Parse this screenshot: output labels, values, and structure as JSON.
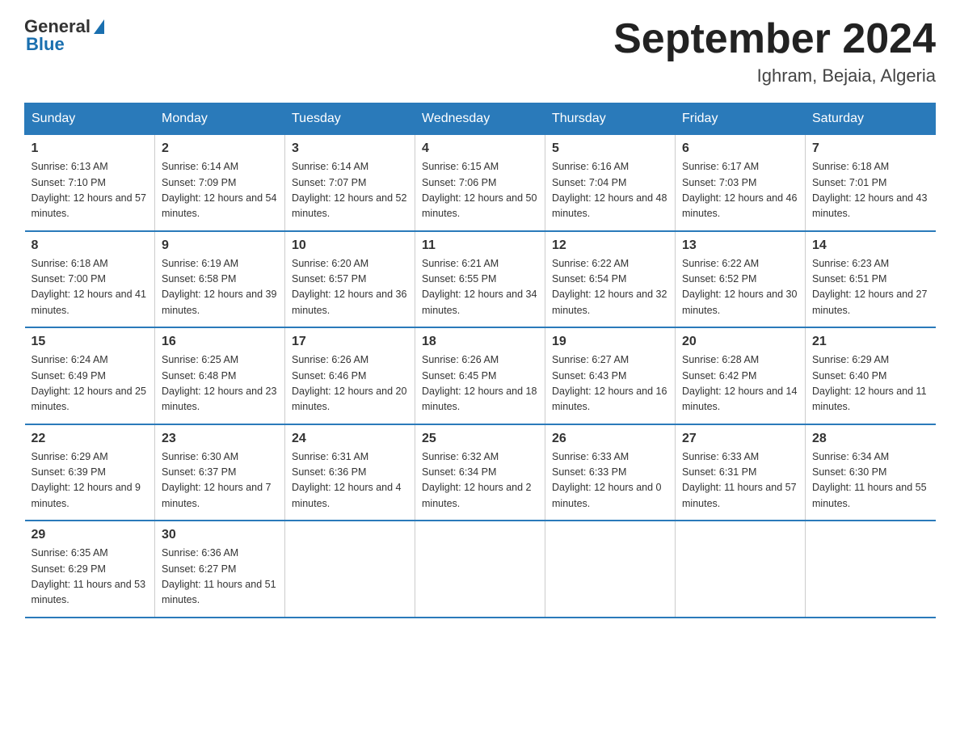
{
  "header": {
    "logo_general": "General",
    "logo_blue": "Blue",
    "title": "September 2024",
    "location": "Ighram, Bejaia, Algeria"
  },
  "columns": [
    "Sunday",
    "Monday",
    "Tuesday",
    "Wednesday",
    "Thursday",
    "Friday",
    "Saturday"
  ],
  "weeks": [
    [
      {
        "day": "1",
        "sunrise": "Sunrise: 6:13 AM",
        "sunset": "Sunset: 7:10 PM",
        "daylight": "Daylight: 12 hours and 57 minutes."
      },
      {
        "day": "2",
        "sunrise": "Sunrise: 6:14 AM",
        "sunset": "Sunset: 7:09 PM",
        "daylight": "Daylight: 12 hours and 54 minutes."
      },
      {
        "day": "3",
        "sunrise": "Sunrise: 6:14 AM",
        "sunset": "Sunset: 7:07 PM",
        "daylight": "Daylight: 12 hours and 52 minutes."
      },
      {
        "day": "4",
        "sunrise": "Sunrise: 6:15 AM",
        "sunset": "Sunset: 7:06 PM",
        "daylight": "Daylight: 12 hours and 50 minutes."
      },
      {
        "day": "5",
        "sunrise": "Sunrise: 6:16 AM",
        "sunset": "Sunset: 7:04 PM",
        "daylight": "Daylight: 12 hours and 48 minutes."
      },
      {
        "day": "6",
        "sunrise": "Sunrise: 6:17 AM",
        "sunset": "Sunset: 7:03 PM",
        "daylight": "Daylight: 12 hours and 46 minutes."
      },
      {
        "day": "7",
        "sunrise": "Sunrise: 6:18 AM",
        "sunset": "Sunset: 7:01 PM",
        "daylight": "Daylight: 12 hours and 43 minutes."
      }
    ],
    [
      {
        "day": "8",
        "sunrise": "Sunrise: 6:18 AM",
        "sunset": "Sunset: 7:00 PM",
        "daylight": "Daylight: 12 hours and 41 minutes."
      },
      {
        "day": "9",
        "sunrise": "Sunrise: 6:19 AM",
        "sunset": "Sunset: 6:58 PM",
        "daylight": "Daylight: 12 hours and 39 minutes."
      },
      {
        "day": "10",
        "sunrise": "Sunrise: 6:20 AM",
        "sunset": "Sunset: 6:57 PM",
        "daylight": "Daylight: 12 hours and 36 minutes."
      },
      {
        "day": "11",
        "sunrise": "Sunrise: 6:21 AM",
        "sunset": "Sunset: 6:55 PM",
        "daylight": "Daylight: 12 hours and 34 minutes."
      },
      {
        "day": "12",
        "sunrise": "Sunrise: 6:22 AM",
        "sunset": "Sunset: 6:54 PM",
        "daylight": "Daylight: 12 hours and 32 minutes."
      },
      {
        "day": "13",
        "sunrise": "Sunrise: 6:22 AM",
        "sunset": "Sunset: 6:52 PM",
        "daylight": "Daylight: 12 hours and 30 minutes."
      },
      {
        "day": "14",
        "sunrise": "Sunrise: 6:23 AM",
        "sunset": "Sunset: 6:51 PM",
        "daylight": "Daylight: 12 hours and 27 minutes."
      }
    ],
    [
      {
        "day": "15",
        "sunrise": "Sunrise: 6:24 AM",
        "sunset": "Sunset: 6:49 PM",
        "daylight": "Daylight: 12 hours and 25 minutes."
      },
      {
        "day": "16",
        "sunrise": "Sunrise: 6:25 AM",
        "sunset": "Sunset: 6:48 PM",
        "daylight": "Daylight: 12 hours and 23 minutes."
      },
      {
        "day": "17",
        "sunrise": "Sunrise: 6:26 AM",
        "sunset": "Sunset: 6:46 PM",
        "daylight": "Daylight: 12 hours and 20 minutes."
      },
      {
        "day": "18",
        "sunrise": "Sunrise: 6:26 AM",
        "sunset": "Sunset: 6:45 PM",
        "daylight": "Daylight: 12 hours and 18 minutes."
      },
      {
        "day": "19",
        "sunrise": "Sunrise: 6:27 AM",
        "sunset": "Sunset: 6:43 PM",
        "daylight": "Daylight: 12 hours and 16 minutes."
      },
      {
        "day": "20",
        "sunrise": "Sunrise: 6:28 AM",
        "sunset": "Sunset: 6:42 PM",
        "daylight": "Daylight: 12 hours and 14 minutes."
      },
      {
        "day": "21",
        "sunrise": "Sunrise: 6:29 AM",
        "sunset": "Sunset: 6:40 PM",
        "daylight": "Daylight: 12 hours and 11 minutes."
      }
    ],
    [
      {
        "day": "22",
        "sunrise": "Sunrise: 6:29 AM",
        "sunset": "Sunset: 6:39 PM",
        "daylight": "Daylight: 12 hours and 9 minutes."
      },
      {
        "day": "23",
        "sunrise": "Sunrise: 6:30 AM",
        "sunset": "Sunset: 6:37 PM",
        "daylight": "Daylight: 12 hours and 7 minutes."
      },
      {
        "day": "24",
        "sunrise": "Sunrise: 6:31 AM",
        "sunset": "Sunset: 6:36 PM",
        "daylight": "Daylight: 12 hours and 4 minutes."
      },
      {
        "day": "25",
        "sunrise": "Sunrise: 6:32 AM",
        "sunset": "Sunset: 6:34 PM",
        "daylight": "Daylight: 12 hours and 2 minutes."
      },
      {
        "day": "26",
        "sunrise": "Sunrise: 6:33 AM",
        "sunset": "Sunset: 6:33 PM",
        "daylight": "Daylight: 12 hours and 0 minutes."
      },
      {
        "day": "27",
        "sunrise": "Sunrise: 6:33 AM",
        "sunset": "Sunset: 6:31 PM",
        "daylight": "Daylight: 11 hours and 57 minutes."
      },
      {
        "day": "28",
        "sunrise": "Sunrise: 6:34 AM",
        "sunset": "Sunset: 6:30 PM",
        "daylight": "Daylight: 11 hours and 55 minutes."
      }
    ],
    [
      {
        "day": "29",
        "sunrise": "Sunrise: 6:35 AM",
        "sunset": "Sunset: 6:29 PM",
        "daylight": "Daylight: 11 hours and 53 minutes."
      },
      {
        "day": "30",
        "sunrise": "Sunrise: 6:36 AM",
        "sunset": "Sunset: 6:27 PM",
        "daylight": "Daylight: 11 hours and 51 minutes."
      },
      null,
      null,
      null,
      null,
      null
    ]
  ]
}
